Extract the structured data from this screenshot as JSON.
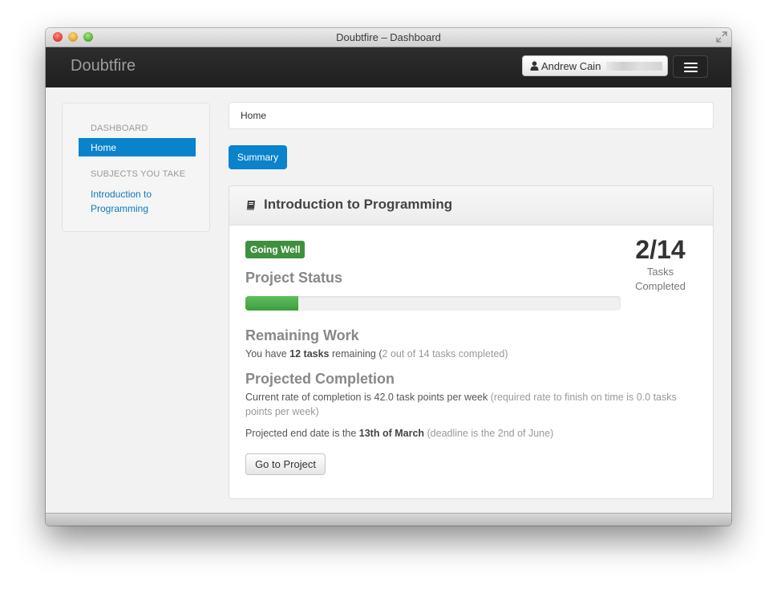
{
  "window": {
    "title": "Doubtfire – Dashboard"
  },
  "navbar": {
    "brand": "Doubtfire",
    "user_name": "Andrew Cain"
  },
  "sidebar": {
    "section_dashboard": "DASHBOARD",
    "home_item": "Home",
    "section_subjects": "SUBJECTS YOU TAKE",
    "subject_link": "Introduction to Programming"
  },
  "breadcrumb": {
    "current": "Home"
  },
  "tabs": {
    "summary": "Summary"
  },
  "panel": {
    "title": "Introduction to Programming",
    "status_badge": "Going Well",
    "project_status_heading": "Project Status",
    "progress_fraction": 0.14,
    "tasks_completed_count": "2/14",
    "tasks_completed_label": "Tasks Completed",
    "remaining_heading": "Remaining Work",
    "remaining_prefix": "You have ",
    "remaining_bold": "12 tasks",
    "remaining_mid": " remaining (",
    "remaining_muted": "2 out of 14 tasks completed)",
    "projected_heading": "Projected Completion",
    "rate_text": "Current rate of completion is 42.0 task points per week",
    "rate_muted": " (required rate to finish on time is 0.0 tasks points per week)",
    "end_prefix": "Projected end date is the ",
    "end_bold": "13th of March",
    "end_muted": " (deadline is the 2nd of June)",
    "go_button": "Go to Project"
  },
  "colors": {
    "accent": "#0a83cc",
    "badge_green": "#3f8f3f",
    "progress_green": "#4cae4c",
    "navbar": "#222222"
  },
  "icons": {
    "user": "user-icon",
    "book": "book-icon",
    "menu": "hamburger-menu-icon",
    "fullscreen": "fullscreen-icon"
  }
}
